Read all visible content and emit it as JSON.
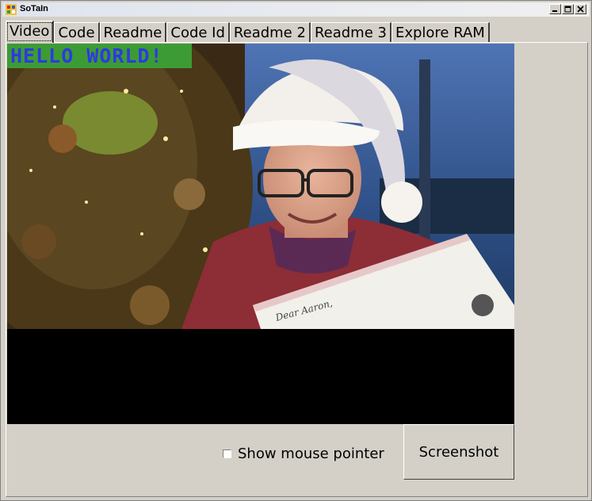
{
  "window": {
    "title": "SoTaIn",
    "icon": "app-icon",
    "controls": [
      "minimize-icon",
      "maximize-icon",
      "close-icon"
    ]
  },
  "tabs": [
    {
      "label": "Video",
      "active": true
    },
    {
      "label": "Code",
      "active": false
    },
    {
      "label": "Readme",
      "active": false
    },
    {
      "label": "Code Id",
      "active": false
    },
    {
      "label": "Readme 2",
      "active": false
    },
    {
      "label": "Readme 3",
      "active": false
    },
    {
      "label": "Explore RAM",
      "active": false
    }
  ],
  "video": {
    "overlay_text": "HELLO WORLD!",
    "overlay_bg_color": "#3d9b35",
    "overlay_text_color": "#2d3ae0",
    "letter_salutation": "Dear Aaron,"
  },
  "controls": {
    "show_mouse_pointer_label": "Show mouse pointer",
    "show_mouse_pointer_checked": false,
    "screenshot_label": "Screenshot"
  },
  "colors": {
    "window_bg": "#d4d0c8",
    "video_bg": "#000000"
  }
}
